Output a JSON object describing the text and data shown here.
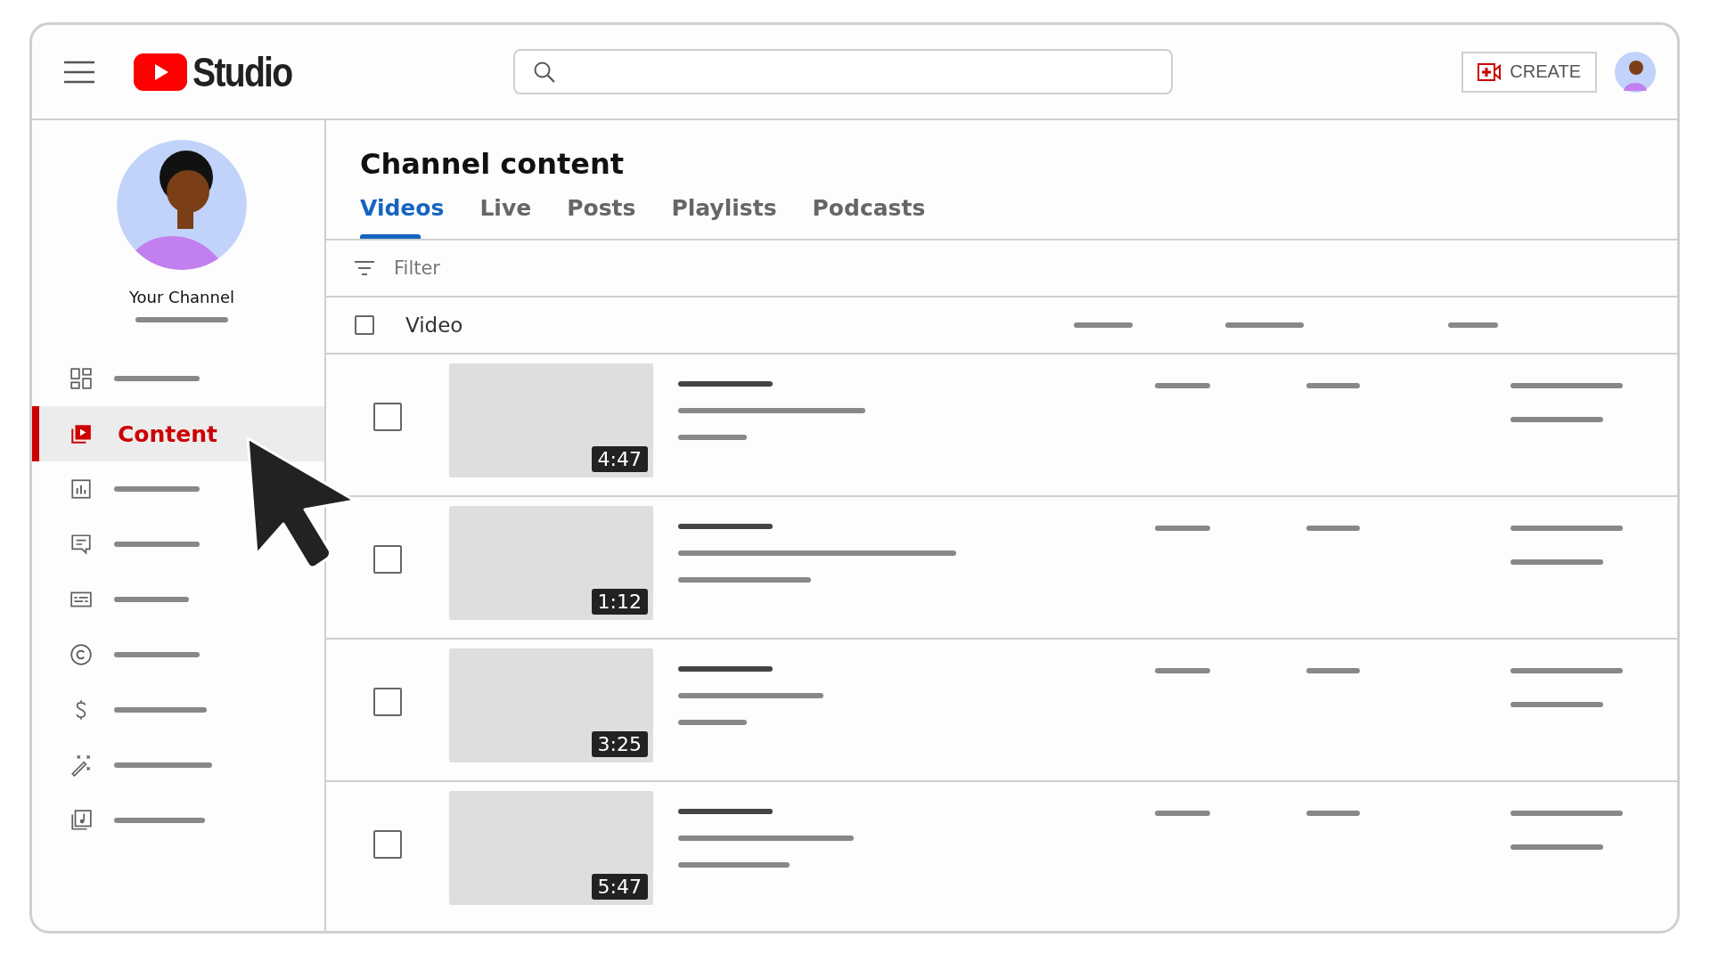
{
  "header": {
    "logo_text": "Studio",
    "create_button": "CREATE"
  },
  "sidebar": {
    "channel_name": "Your Channel",
    "items": [
      {
        "selected": false
      },
      {
        "label": "Content",
        "selected": true
      },
      {
        "selected": false
      },
      {
        "selected": false
      },
      {
        "selected": false
      },
      {
        "selected": false
      },
      {
        "selected": false
      },
      {
        "selected": false
      },
      {
        "selected": false
      }
    ]
  },
  "page_title": "Channel content",
  "tabs": [
    {
      "label": "Videos",
      "selected": true
    },
    {
      "label": "Live",
      "selected": false
    },
    {
      "label": "Posts",
      "selected": false
    },
    {
      "label": "Playlists",
      "selected": false
    },
    {
      "label": "Podcasts",
      "selected": false
    }
  ],
  "filter": {
    "placeholder": "Filter"
  },
  "table": {
    "columns": [
      "Video"
    ],
    "header_checkbox": {
      "checked": false
    },
    "rows": [
      {
        "duration": "4:47",
        "checked": false
      },
      {
        "duration": "1:12",
        "checked": false
      },
      {
        "duration": "3:25",
        "checked": false
      },
      {
        "duration": "5:47",
        "checked": false
      }
    ]
  }
}
